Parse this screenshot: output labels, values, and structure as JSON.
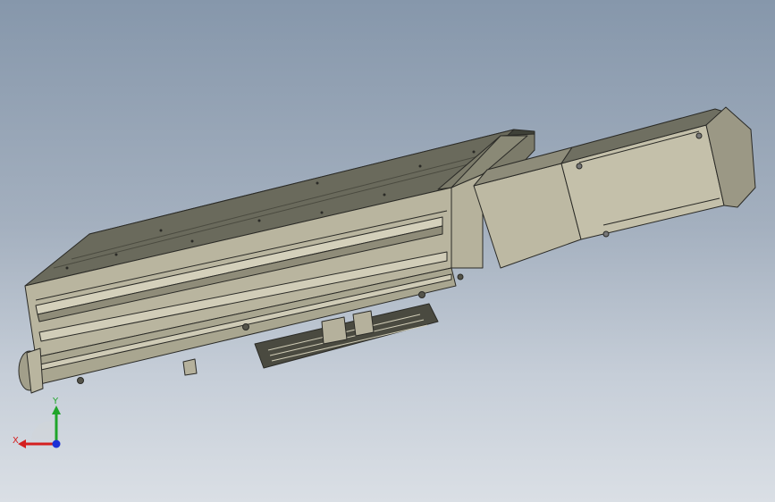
{
  "viewport": {
    "background_top": "#8697ab",
    "background_bottom": "#dadfe5",
    "model": {
      "name": "linear-actuator-with-servo-motor",
      "body_color": "#b9b59f",
      "edge_color": "#2a2a26"
    }
  },
  "triad": {
    "x_label": "X",
    "y_label": "Y",
    "x_color": "#d42020",
    "y_color": "#1fa52a",
    "z_color": "#1c2fd6"
  }
}
